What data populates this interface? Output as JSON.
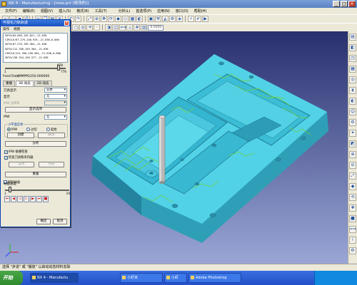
{
  "window": {
    "title": "NX 4 - Manufacturing - [moo.prt (修改的)]"
  },
  "menubar": [
    "文件(F)",
    "编辑(E)",
    "视图(V)",
    "插入(S)",
    "格式(R)",
    "工具(T)",
    "",
    "分析(L)",
    "首选项(P)",
    "应用(N)",
    "窗口(O)",
    "帮助(H)"
  ],
  "toolbar": {
    "dropdown": "Start Assembl",
    "mode": "0.0000"
  },
  "dialog": {
    "title": "可视化刀轨轨迹",
    "menu": [
      "操作",
      "视图"
    ],
    "nc_lines": [
      "GOTO/84.665,133.621,-21.636",
      "CIRCLE/67.275,140.919,-21.636,0.000",
      "GOTO/67.275,159.364,-21.636",
      "GOTO/111.350,159.364,-21.636",
      "CIRCLE/121.350,150.364,-21.636,0.000",
      "GOTO/130.324,150.377,-21.636"
    ],
    "slider_min": "1",
    "slider_max": "776",
    "slider_value": "678",
    "feed_rate_label": "Feed Rate",
    "feed_rate_unit": "(MMPM)",
    "feed_rate_value": "250.000000",
    "tabs": [
      "重播",
      "3D 动态",
      "2D 动态"
    ],
    "tool_display_label": "刀具显示",
    "tool_display_value": "实体",
    "display_label": "显示",
    "display_value": "无",
    "ipw_resolution_label": "IPW 分辨率",
    "display_options_button": "显示选项",
    "ipw_label": "IPW",
    "ipw_value": "无",
    "group_label": "小平面实体",
    "radios": [
      "IPW",
      "过切",
      "起始"
    ],
    "create_button": "创建",
    "delete_button": "删除",
    "analyze_button": "分析",
    "check_ipw_collision": "IPW 碰撞检查",
    "check_tool_holder": "检查刀具和夹持器",
    "options_button": "选项",
    "list_button": "列表",
    "reset_button": "重置",
    "suppress_anim": "抑制动画",
    "anim_speed_label": "动画速度",
    "speed_min": "1",
    "speed_max": "10",
    "ok_button": "确定",
    "cancel_button": "取消"
  },
  "statusbar": {
    "text": "选择 \"步进\" 或 \"播放\" 以启动动态材料去除"
  },
  "taskbar": {
    "start": "开始",
    "items": [
      "NX 4 - Manufactu",
      "小虾米",
      "小虾",
      "Adobe Photoshop"
    ],
    "clock": ""
  }
}
